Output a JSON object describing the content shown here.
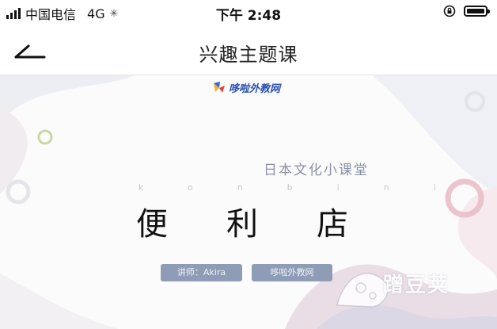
{
  "status_bar": {
    "carrier": "中国电信",
    "network": "4G",
    "time": "下午 2:48",
    "icons": [
      "signal-icon",
      "loading-spinner-icon",
      "rotation-lock-icon",
      "battery-icon"
    ]
  },
  "nav": {
    "back_icon": "back-arrow-icon",
    "title": "兴趣主题课"
  },
  "slide": {
    "logo_text": "哆啦外教网",
    "subtitle": "日本文化小课堂",
    "romaji": "konbini",
    "title": "便利店",
    "teacher_label": "讲师：Akira",
    "brand_label": "哆啦外教网",
    "watermark_text": "蹭豆荚",
    "colors": {
      "pill": "#8e9cb6",
      "subtitle": "#8a90a4",
      "logo": "#2a4fb3",
      "accent_pink": "#e9b7c2",
      "accent_green": "#c9d8a0"
    }
  }
}
